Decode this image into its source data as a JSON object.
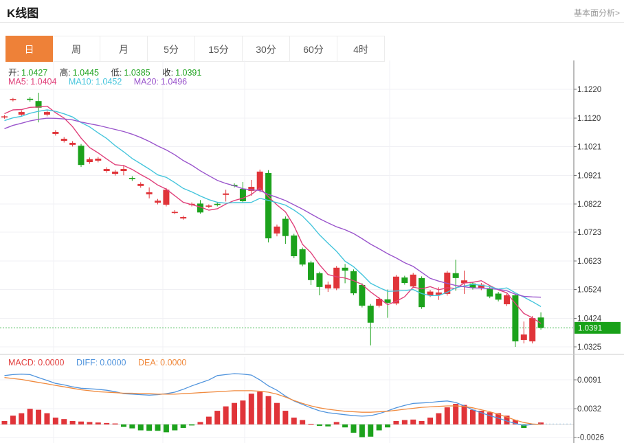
{
  "header": {
    "title": "K线图",
    "link": "基本面分析>"
  },
  "tabs": {
    "items": [
      "日",
      "周",
      "月",
      "5分",
      "15分",
      "30分",
      "60分",
      "4时"
    ],
    "active": "日"
  },
  "ohlc": {
    "o_label": "开:",
    "o": "1.0427",
    "h_label": "高:",
    "h": "1.0445",
    "l_label": "低:",
    "l": "1.0385",
    "c_label": "收:",
    "c": "1.0391"
  },
  "ma_legend": {
    "ma5_label": "MA5:",
    "ma5": "1.0404",
    "ma10_label": "MA10:",
    "ma10": "1.0452",
    "ma20_label": "MA20:",
    "ma20": "1.0496"
  },
  "macd_legend": {
    "macd_label": "MACD:",
    "macd": "0.0000",
    "diff_label": "DIFF:",
    "diff": "0.0000",
    "dea_label": "DEA:",
    "dea": "0.0000"
  },
  "colors": {
    "up": "#e03439",
    "down": "#1ca21c",
    "ma5": "#e0407a",
    "ma10": "#45c5dc",
    "ma20": "#9a55cc",
    "diff": "#5094dd",
    "dea": "#f08a3e",
    "macd_label": "#e2403f",
    "tab_active": "#ee8138",
    "badge": "#18a118",
    "price_line": "#3cb54a",
    "grid": "#f0f0f4",
    "axis": "#777777",
    "tick_text": "#3a3a3a",
    "zero_line": "#d8d8d8",
    "end_dotted": "#a8cdea"
  },
  "chart_data": [
    {
      "type": "candlestick",
      "title": "K线图 daily candles with MA5/MA10/MA20",
      "y_tick_labels": [
        "1.1220",
        "1.1120",
        "1.1021",
        "1.0921",
        "1.0822",
        "1.0723",
        "1.0623",
        "1.0524",
        "1.0424",
        "1.0325"
      ],
      "current_price": 1.0391,
      "current_price_label": "1.0391",
      "ma_periods": [
        5,
        10,
        20
      ],
      "pre_closes": [
        1.092,
        1.096,
        1.099,
        1.102,
        1.1045,
        1.1065,
        1.108,
        1.1092,
        1.11,
        1.1105,
        1.1095,
        1.109,
        1.1085,
        1.108,
        1.1085,
        1.1095,
        1.112,
        1.1135,
        1.1145,
        1.115
      ],
      "candles": [
        [
          1.1122,
          1.113,
          1.1118,
          1.1126
        ],
        [
          1.1182,
          1.119,
          1.1178,
          1.1186
        ],
        [
          1.1132,
          1.1147,
          1.1126,
          1.1141
        ],
        [
          1.1187,
          1.1193,
          1.1177,
          1.1183
        ],
        [
          1.1179,
          1.1208,
          1.1105,
          1.1156
        ],
        [
          1.1132,
          1.1147,
          1.1126,
          1.1141
        ],
        [
          1.1065,
          1.1078,
          1.1059,
          1.1072
        ],
        [
          1.1041,
          1.1054,
          1.1035,
          1.1048
        ],
        [
          1.1027,
          1.104,
          1.1021,
          1.1034
        ],
        [
          1.1024,
          1.103,
          1.095,
          1.0957
        ],
        [
          1.0967,
          1.0983,
          1.0961,
          1.0977
        ],
        [
          1.0972,
          1.0985,
          1.0966,
          1.0979
        ],
        [
          1.0936,
          1.0949,
          1.093,
          1.0943
        ],
        [
          1.0926,
          1.094,
          1.092,
          1.0934
        ],
        [
          1.0936,
          1.0957,
          1.0921,
          1.0943
        ],
        [
          1.0912,
          1.0918,
          1.0902,
          1.0908
        ],
        [
          1.0884,
          1.0897,
          1.0878,
          1.0891
        ],
        [
          1.0855,
          1.0879,
          1.0841,
          1.0862
        ],
        [
          1.0826,
          1.0839,
          1.082,
          1.0833
        ],
        [
          1.0819,
          1.0877,
          1.0813,
          1.0871
        ],
        [
          1.079,
          1.08,
          1.0786,
          1.0794
        ],
        [
          1.0771,
          1.0781,
          1.0767,
          1.0776
        ],
        [
          1.0818,
          1.0827,
          1.0813,
          1.0822
        ],
        [
          1.0823,
          1.0835,
          1.0788,
          1.0792
        ],
        [
          1.0812,
          1.082,
          1.0807,
          1.0816
        ],
        [
          1.0822,
          1.0828,
          1.0813,
          1.0818
        ],
        [
          1.0853,
          1.0871,
          1.083,
          1.0858
        ],
        [
          1.0888,
          1.0893,
          1.0879,
          1.0884
        ],
        [
          1.0874,
          1.0898,
          1.0826,
          1.0831
        ],
        [
          1.0867,
          1.0905,
          1.085,
          1.0881
        ],
        [
          1.0869,
          1.0941,
          1.0862,
          1.0934
        ],
        [
          1.0929,
          1.0939,
          1.0688,
          1.0702
        ],
        [
          1.0719,
          1.075,
          1.0709,
          1.0743
        ],
        [
          1.077,
          1.0778,
          1.0683,
          1.071
        ],
        [
          1.0712,
          1.0718,
          1.0633,
          1.064
        ],
        [
          1.0664,
          1.067,
          1.0605,
          1.0611
        ],
        [
          1.0618,
          1.0624,
          1.054,
          1.0557
        ],
        [
          1.0581,
          1.0586,
          1.0504,
          1.0533
        ],
        [
          1.0528,
          1.0552,
          1.0516,
          1.0541
        ],
        [
          1.0528,
          1.0606,
          1.0522,
          1.06
        ],
        [
          1.06,
          1.0613,
          1.0546,
          1.059
        ],
        [
          1.0588,
          1.0594,
          1.0505,
          1.0511
        ],
        [
          1.054,
          1.0546,
          1.0462,
          1.0468
        ],
        [
          1.0468,
          1.0474,
          1.033,
          1.0409
        ],
        [
          1.0468,
          1.0498,
          1.0462,
          1.0492
        ],
        [
          1.049,
          1.0524,
          1.0426,
          1.0478
        ],
        [
          1.0476,
          1.0575,
          1.047,
          1.0569
        ],
        [
          1.0566,
          1.0572,
          1.0541,
          1.0547
        ],
        [
          1.0535,
          1.0582,
          1.0529,
          1.0576
        ],
        [
          1.0564,
          1.057,
          1.0457,
          1.0463
        ],
        [
          1.0504,
          1.0523,
          1.0498,
          1.0517
        ],
        [
          1.0506,
          1.0532,
          1.0488,
          1.0514
        ],
        [
          1.0509,
          1.0589,
          1.0503,
          1.0583
        ],
        [
          1.0581,
          1.0628,
          1.052,
          1.0564
        ],
        [
          1.0546,
          1.059,
          1.0509,
          1.0556
        ],
        [
          1.0545,
          1.0551,
          1.0524,
          1.053
        ],
        [
          1.0528,
          1.0547,
          1.0522,
          1.0541
        ],
        [
          1.0529,
          1.0535,
          1.0494,
          1.05
        ],
        [
          1.051,
          1.0516,
          1.0483,
          1.0489
        ],
        [
          1.0473,
          1.051,
          1.0467,
          1.0504
        ],
        [
          1.0504,
          1.051,
          1.0325,
          1.0344
        ],
        [
          1.0349,
          1.0413,
          1.0337,
          1.0368
        ],
        [
          1.0344,
          1.0432,
          1.0337,
          1.0425
        ],
        [
          1.0427,
          1.0445,
          1.0385,
          1.0391
        ]
      ]
    },
    {
      "type": "macd",
      "title": "MACD histogram with DIFF/DEA lines",
      "y_tick_labels": [
        "0.0091",
        "0.0032",
        "-0.0026"
      ],
      "hist": [
        0.0007,
        0.0018,
        0.0023,
        0.0032,
        0.003,
        0.0023,
        0.0014,
        0.0011,
        0.0007,
        0.0006,
        0.0005,
        0.0004,
        0.0003,
        0.0002,
        -0.0005,
        -0.0008,
        -0.0012,
        -0.0013,
        -0.0013,
        -0.0016,
        -0.0012,
        -0.0007,
        -0.0002,
        0.0005,
        0.0016,
        0.0028,
        0.0037,
        0.0044,
        0.0049,
        0.0063,
        0.0067,
        0.0058,
        0.0044,
        0.0028,
        0.0014,
        0.0009,
        0.0001,
        -0.0003,
        -0.0004,
        0.0005,
        -0.0006,
        -0.0017,
        -0.0026,
        -0.0025,
        -0.0012,
        -0.0006,
        0.0007,
        0.0009,
        0.001,
        0.0007,
        0.0014,
        0.0023,
        0.0035,
        0.0042,
        0.004,
        0.003,
        0.0028,
        0.0025,
        0.0023,
        0.0018,
        0.0009,
        -0.0007,
        0.0001,
        0.0004
      ],
      "diff": [
        0.01,
        0.0102,
        0.0103,
        0.0102,
        0.0096,
        0.009,
        0.0084,
        0.0081,
        0.0077,
        0.0074,
        0.0073,
        0.0072,
        0.007,
        0.0067,
        0.0063,
        0.0062,
        0.0061,
        0.006,
        0.0061,
        0.0063,
        0.0066,
        0.0072,
        0.0079,
        0.0085,
        0.0091,
        0.01,
        0.0102,
        0.0104,
        0.0103,
        0.0101,
        0.0091,
        0.0079,
        0.007,
        0.0058,
        0.0048,
        0.0041,
        0.0034,
        0.0028,
        0.0024,
        0.0022,
        0.002,
        0.0018,
        0.0017,
        0.0018,
        0.0022,
        0.0028,
        0.0034,
        0.0039,
        0.0043,
        0.0044,
        0.0045,
        0.0047,
        0.0048,
        0.0045,
        0.0038,
        0.003,
        0.0024,
        0.0018,
        0.0013,
        0.0007,
        0.0002,
        -0.0002,
        0.0,
        0.0001
      ],
      "dea": [
        0.0096,
        0.0094,
        0.0092,
        0.0089,
        0.0086,
        0.0083,
        0.008,
        0.0077,
        0.0074,
        0.0071,
        0.0069,
        0.0067,
        0.0066,
        0.0065,
        0.0064,
        0.0064,
        0.0063,
        0.0063,
        0.0062,
        0.0062,
        0.0062,
        0.0063,
        0.0064,
        0.0065,
        0.0066,
        0.0067,
        0.0068,
        0.0069,
        0.0069,
        0.0069,
        0.0068,
        0.0066,
        0.0062,
        0.0056,
        0.0049,
        0.0043,
        0.0038,
        0.0034,
        0.0031,
        0.0029,
        0.0027,
        0.0026,
        0.0025,
        0.0025,
        0.0026,
        0.0027,
        0.0029,
        0.0031,
        0.0033,
        0.0035,
        0.0036,
        0.0037,
        0.0038,
        0.0038,
        0.0037,
        0.0034,
        0.003,
        0.0026,
        0.0021,
        0.0015,
        0.0009,
        0.0004,
        0.0001,
        0.0
      ]
    }
  ]
}
